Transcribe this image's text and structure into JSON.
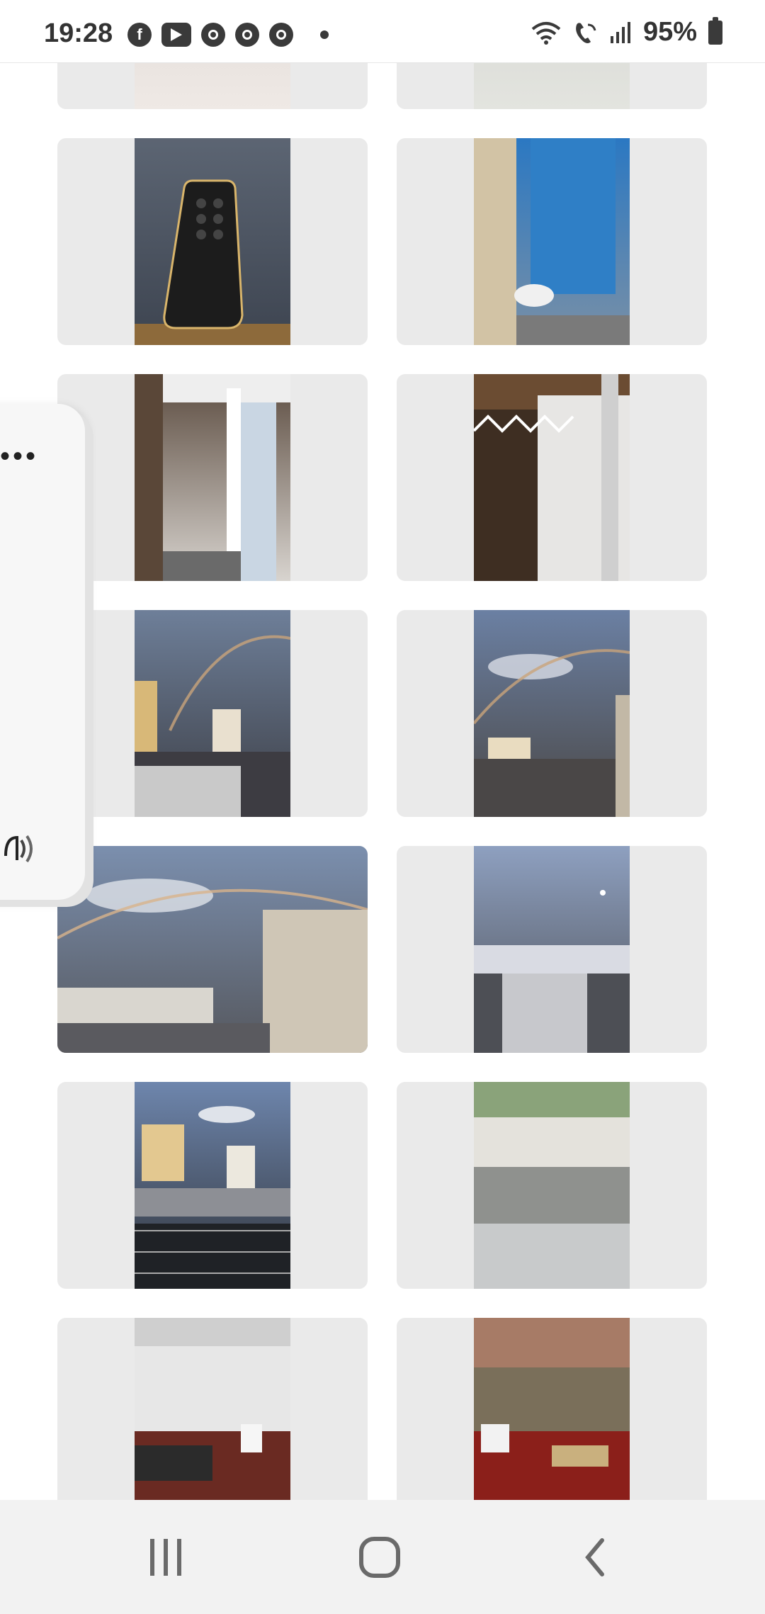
{
  "status_bar": {
    "time": "19:28",
    "battery": "95%",
    "left_icons": [
      "facebook-icon",
      "youtube-icon",
      "chrome-icon",
      "chrome-icon",
      "chrome-icon",
      "dot-icon"
    ],
    "right_icons": [
      "wifi-icon",
      "wifi-call-icon",
      "signal-icon",
      "battery-icon"
    ]
  },
  "gallery": {
    "photos": [
      {
        "name": "tiles-floor-photo",
        "orientation": "portrait",
        "colors": [
          "#d9d3cf",
          "#efe9e5"
        ]
      },
      {
        "name": "floor-photo",
        "orientation": "portrait",
        "colors": [
          "#cfd1cc",
          "#e3e4df"
        ]
      },
      {
        "name": "remote-control-photo",
        "orientation": "portrait",
        "colors": [
          "#5c6573",
          "#3d4450"
        ]
      },
      {
        "name": "bathroom-shower-curtain-photo",
        "orientation": "portrait",
        "colors": [
          "#2b78c2",
          "#7a90a6"
        ]
      },
      {
        "name": "hallway-photo",
        "orientation": "portrait",
        "colors": [
          "#5a4a3e",
          "#d8d4cf"
        ]
      },
      {
        "name": "window-grille-photo",
        "orientation": "portrait",
        "colors": [
          "#6b4c32",
          "#e8e6e4"
        ]
      },
      {
        "name": "rainbow-city-photo-1",
        "orientation": "portrait",
        "colors": [
          "#6e7f99",
          "#3c3e45"
        ]
      },
      {
        "name": "rainbow-city-photo-2",
        "orientation": "portrait",
        "colors": [
          "#6b80a3",
          "#4a4745"
        ]
      },
      {
        "name": "rainbow-city-landscape-photo",
        "orientation": "landscape",
        "colors": [
          "#7b8fae",
          "#55575d"
        ]
      },
      {
        "name": "evening-city-photo",
        "orientation": "portrait",
        "colors": [
          "#8ea0c0",
          "#4d4f55"
        ]
      },
      {
        "name": "balcony-city-photo",
        "orientation": "portrait",
        "colors": [
          "#6e86ad",
          "#2f3238"
        ]
      },
      {
        "name": "building-lobby-photo",
        "orientation": "portrait",
        "colors": [
          "#c7c6c0",
          "#8f918e"
        ]
      },
      {
        "name": "lobby-interior-photo-1",
        "orientation": "portrait",
        "colors": [
          "#d7d7d7",
          "#6a2a22"
        ]
      },
      {
        "name": "lobby-interior-photo-2",
        "orientation": "portrait",
        "colors": [
          "#a77b66",
          "#8b1f1a"
        ]
      }
    ]
  },
  "floating_panel": {
    "menu_icon": "more-dots-icon",
    "audio_icon": "sound-wave-icon"
  },
  "navigation": {
    "recent_apps_icon": "recent-apps-icon",
    "home_icon": "home-icon",
    "back_icon": "back-icon"
  }
}
